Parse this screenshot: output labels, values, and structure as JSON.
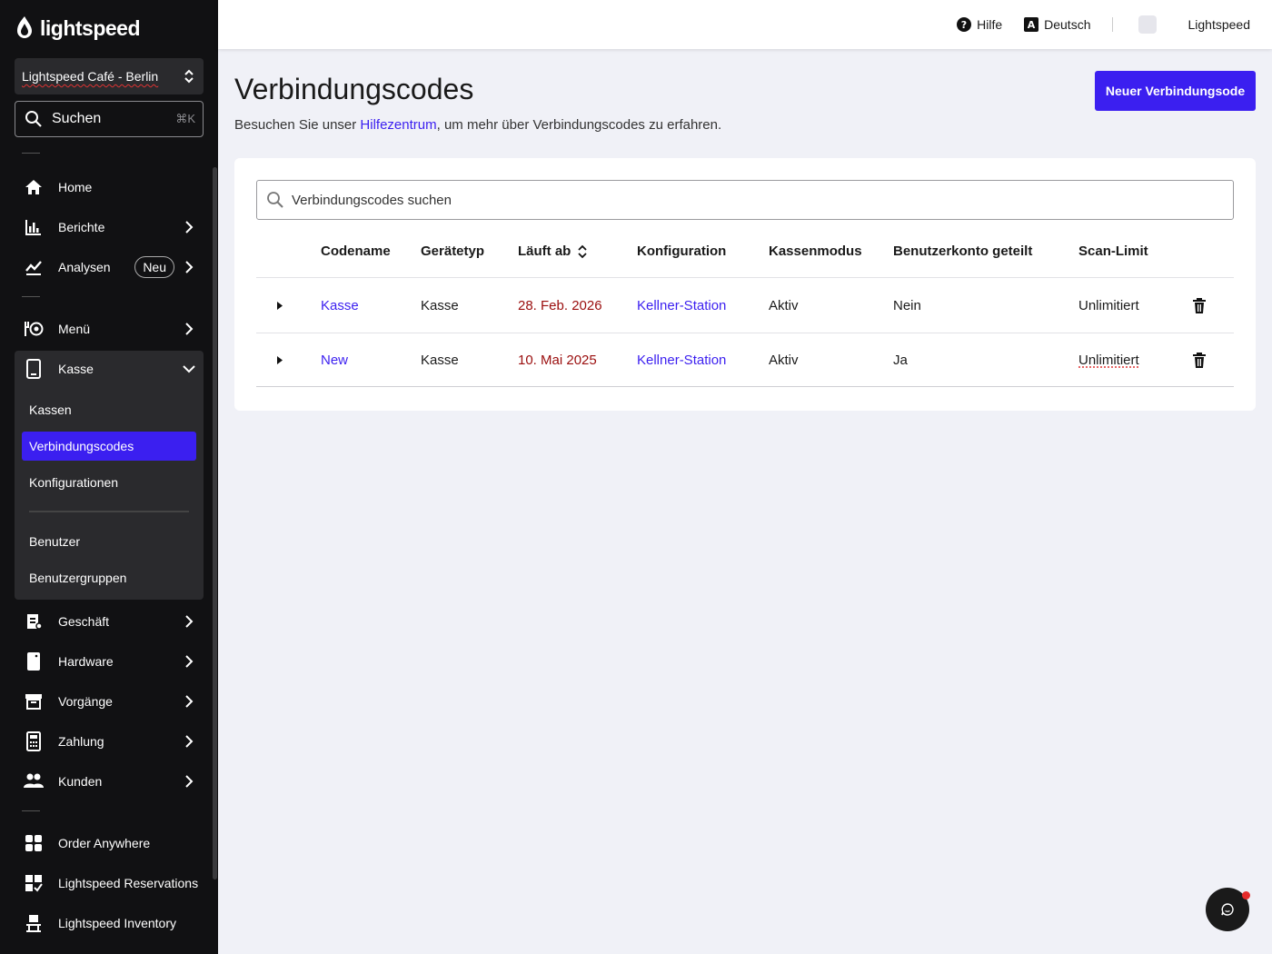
{
  "app": {
    "logo_text": "lightspeed"
  },
  "sidebar": {
    "store_name": "Lightspeed Café - Berlin",
    "search_label": "Suchen",
    "search_shortcut": "⌘K",
    "items": [
      {
        "label": "Home",
        "icon": "home-icon"
      },
      {
        "label": "Berichte",
        "icon": "bar-chart-icon"
      },
      {
        "label": "Analysen",
        "icon": "trend-icon",
        "badge": "Neu"
      },
      {
        "label": "Menü",
        "icon": "menu-dish-icon"
      },
      {
        "label": "Kasse",
        "icon": "tablet-icon"
      },
      {
        "label": "Geschäft",
        "icon": "store-icon"
      },
      {
        "label": "Hardware",
        "icon": "device-icon"
      },
      {
        "label": "Vorgänge",
        "icon": "archive-icon"
      },
      {
        "label": "Zahlung",
        "icon": "calculator-icon"
      },
      {
        "label": "Kunden",
        "icon": "people-icon"
      },
      {
        "label": "Order Anywhere",
        "icon": "grid-icon"
      },
      {
        "label": "Lightspeed Reservations",
        "icon": "reservation-icon"
      },
      {
        "label": "Lightspeed Inventory",
        "icon": "inventory-icon"
      }
    ],
    "kasse_sub": [
      "Kassen",
      "Verbindungscodes",
      "Konfigurationen",
      "Benutzer",
      "Benutzergruppen"
    ],
    "active_sub": "Verbindungscodes"
  },
  "topbar": {
    "help": "Hilfe",
    "language": "Deutsch",
    "user": "Lightspeed"
  },
  "page": {
    "title": "Verbindungscodes",
    "subtitle_before": "Besuchen Sie unser ",
    "subtitle_link": "Hilfezentrum",
    "subtitle_after": ", um mehr über Verbindungscodes zu erfahren.",
    "new_button": "Neuer Verbindungsode",
    "search_placeholder": "Verbindungscodes suchen"
  },
  "table": {
    "columns": [
      "Codename",
      "Gerätetyp",
      "Läuft ab",
      "Konfiguration",
      "Kassenmodus",
      "Benutzerkonto geteilt",
      "Scan-Limit"
    ],
    "rows": [
      {
        "codename": "Kasse",
        "device": "Kasse",
        "expires": "28. Feb. 2026",
        "config": "Kellner-Station",
        "mode": "Aktiv",
        "shared": "Nein",
        "limit": "Unlimitiert"
      },
      {
        "codename": "New",
        "device": "Kasse",
        "expires": "10. Mai 2025",
        "config": "Kellner-Station",
        "mode": "Aktiv",
        "shared": "Ja",
        "limit": "Unlimitiert"
      }
    ]
  },
  "colors": {
    "accent": "#3b1ff0",
    "sidebar_bg": "#111113",
    "date_red": "#9a0d0d"
  }
}
